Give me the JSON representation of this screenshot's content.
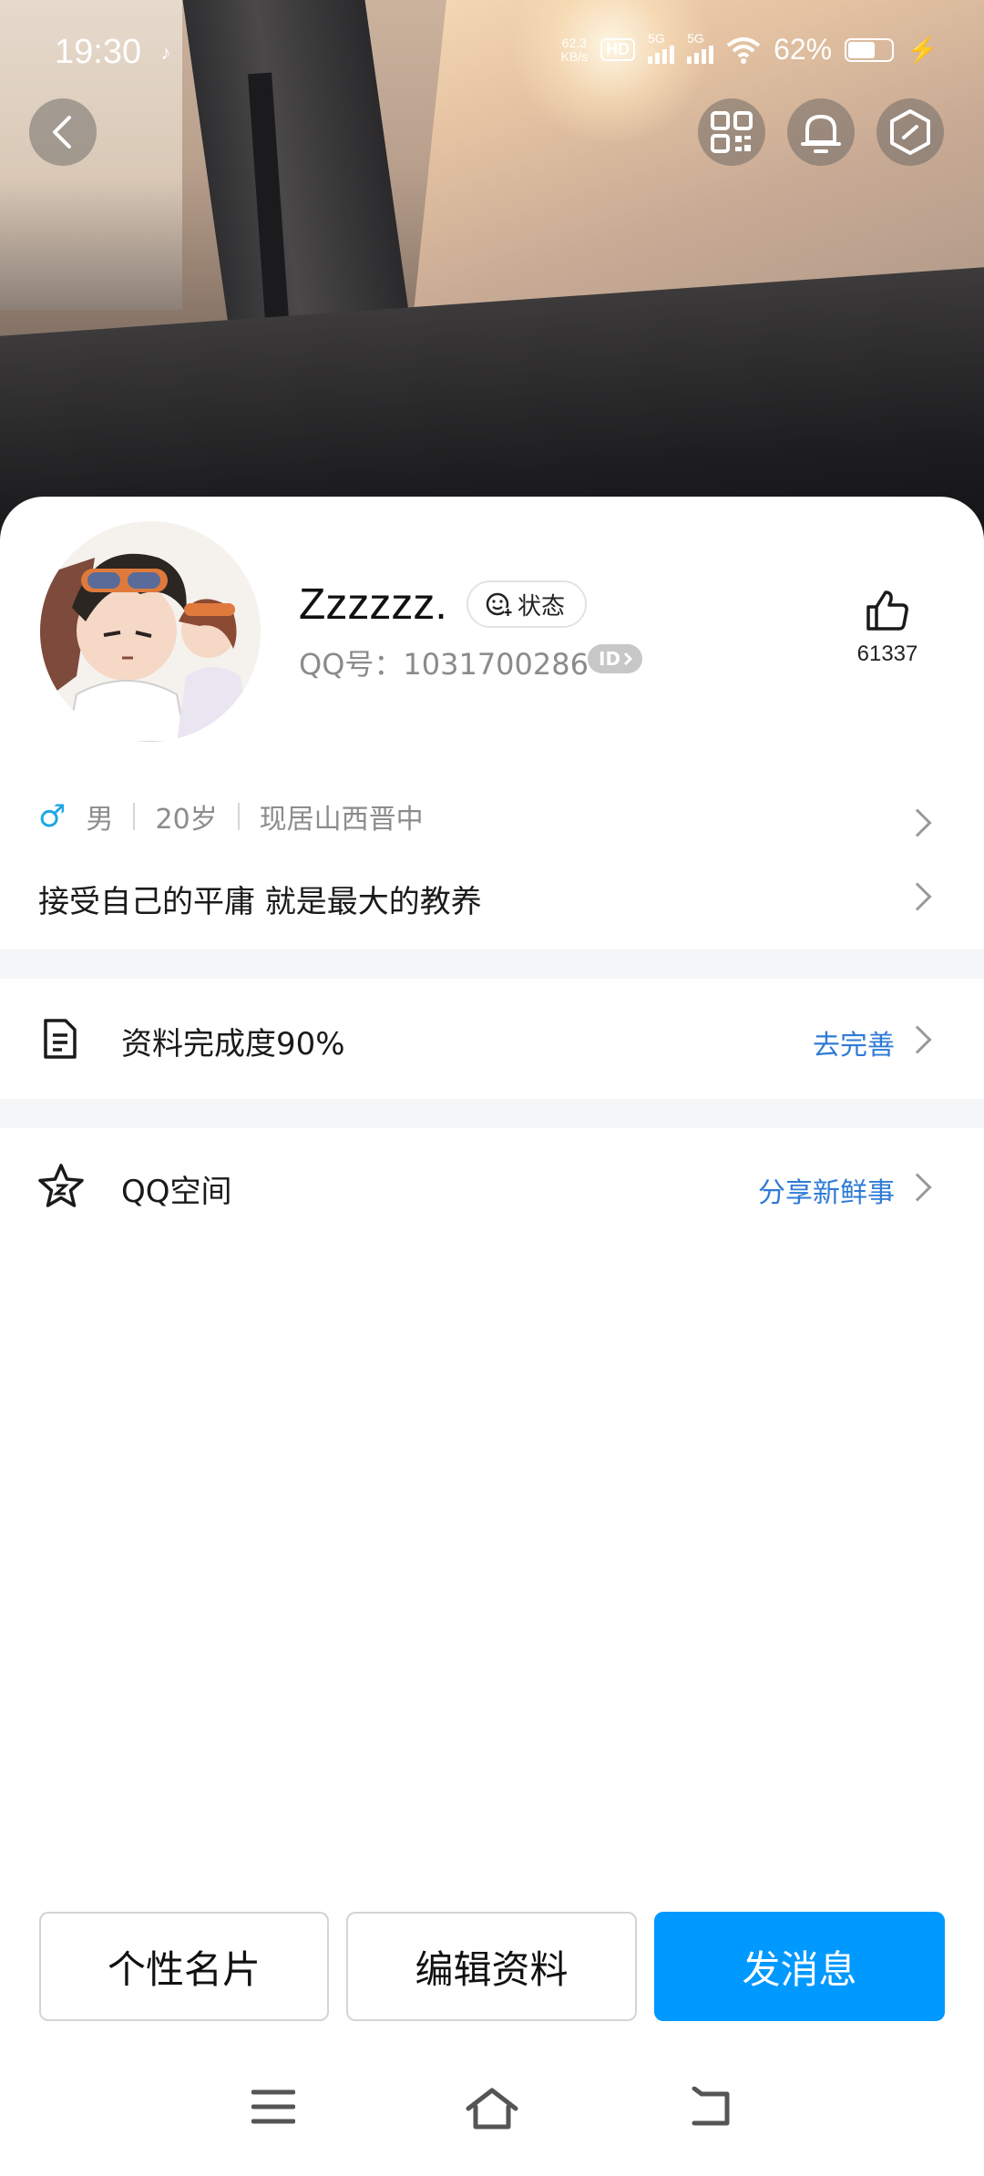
{
  "status_bar": {
    "time": "19:30",
    "net_speed_value": "62.3",
    "net_speed_unit": "KB/s",
    "hd": "HD",
    "sim1_label": "5G",
    "sim2_label": "5G",
    "battery": "62%",
    "battery_level": 0.62
  },
  "profile": {
    "name": "Zzzzzz.",
    "status_label": "状态",
    "qq_number": "QQ号：1031700286",
    "id_badge": "ID",
    "likes": "61337"
  },
  "info": {
    "gender": "男",
    "age": "20岁",
    "location": "现居山西晋中",
    "signature": "接受自己的平庸 就是最大的教养"
  },
  "rows": {
    "completion_title": "资料完成度90%",
    "completion_action": "去完善",
    "qzone_title": "QQ空间",
    "qzone_action": "分享新鲜事"
  },
  "buttons": {
    "card": "个性名片",
    "edit": "编辑资料",
    "message": "发消息"
  },
  "colors": {
    "accent": "#0099ff",
    "link": "#2f7bd6",
    "male": "#1fa7e6"
  }
}
